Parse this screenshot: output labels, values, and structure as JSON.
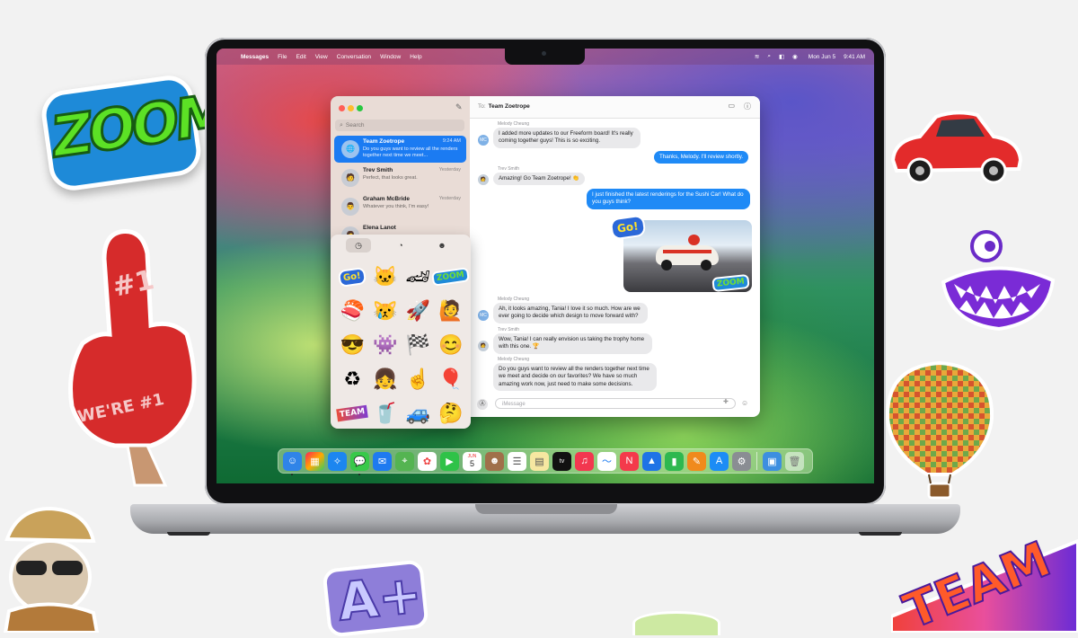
{
  "menubar": {
    "apple": "",
    "app": "Messages",
    "items": [
      "File",
      "Edit",
      "View",
      "Conversation",
      "Window",
      "Help"
    ],
    "date": "Mon Jun 5",
    "time": "9:41 AM"
  },
  "sidebar": {
    "search_placeholder": "Search",
    "conversations": [
      {
        "name": "Team Zoetrope",
        "time": "9:24 AM",
        "preview": "Do you guys want to review all the renders together next time we meet...",
        "selected": true
      },
      {
        "name": "Trev Smith",
        "time": "Yesterday",
        "preview": "Perfect, that looks great."
      },
      {
        "name": "Graham McBride",
        "time": "Yesterday",
        "preview": "Whatever you think, I'm easy!"
      },
      {
        "name": "Elena Lanot",
        "time": "",
        "preview": ""
      }
    ]
  },
  "chat": {
    "to_label": "To:",
    "to_name": "Team Zoetrope",
    "messages": [
      {
        "sender": "Melody Cheung",
        "text": "I added more updates to our Freeform board! It's really coming together guys! This is so exciting."
      },
      {
        "text": "Thanks, Melody. I'll review shortly."
      },
      {
        "sender": "Trev Smith",
        "text": "Amazing! Go Team Zoetrope! 👏"
      },
      {
        "text": "I just finished the latest renderings for the Sushi Car! What do you guys think?"
      },
      {
        "sender": "Melody Cheung",
        "text": "Ah, it looks amazing, Tania! I love it so much. How are we ever going to decide which design to move forward with?"
      },
      {
        "sender": "Trev Smith",
        "text": "Wow, Tania! I can really envision us taking the trophy home with this one. 🏆"
      },
      {
        "sender": "Melody Cheung",
        "text": "Do you guys want to review all the renders together next time we meet and decide on our favorites? We have so much amazing work now, just need to make some decisions."
      }
    ],
    "avatar_initials": "MC",
    "input_placeholder": "iMessage",
    "photo_stickers": {
      "go": "Go!",
      "zoom": "ZOOM"
    }
  },
  "sticker_picker": {
    "go": "Go!",
    "zoom": "ZOOM",
    "team": "TEAM"
  },
  "decor_stickers": {
    "zoom": "ZOOM",
    "aplus": "A+",
    "team": "TEAM",
    "foam_finger_top": "#1",
    "foam_finger_bottom": "WE'RE #1"
  },
  "dock": {
    "calendar_month": "JUN",
    "calendar_day": "5",
    "tv_label": "tv"
  }
}
